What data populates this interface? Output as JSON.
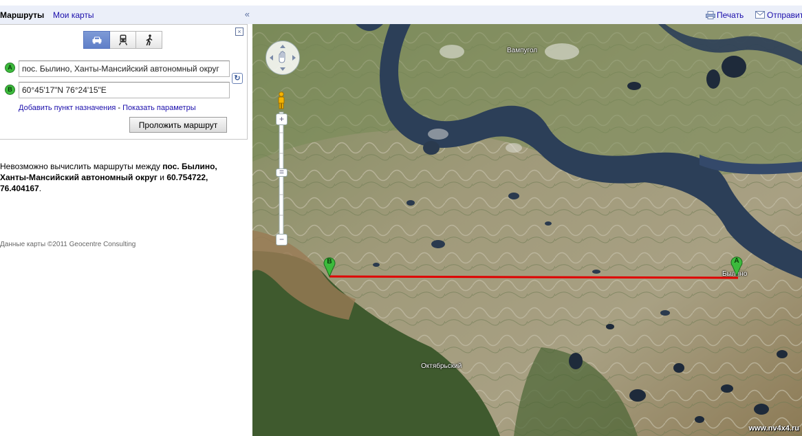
{
  "sidebar": {
    "tabs": {
      "directions": "Маршруты",
      "my_maps": "Мои карты"
    },
    "collapse_glyph": "«",
    "close_glyph": "×",
    "modes": [
      {
        "icon": "car-icon",
        "active": true
      },
      {
        "icon": "transit-icon",
        "active": false
      },
      {
        "icon": "walking-icon",
        "active": false
      }
    ],
    "route": {
      "a": {
        "marker": "A",
        "value": "пос. Былино, Ханты-Мансийский автономный округ"
      },
      "b": {
        "marker": "B",
        "value": "60°45'17\"N 76°24'15\"E"
      }
    },
    "links": {
      "add_destination": "Добавить пункт назначения",
      "separator": " - ",
      "show_options": "Показать параметры"
    },
    "get_directions_button": "Проложить маршрут",
    "error": {
      "prefix": "Невозможно вычислить маршруты между ",
      "origin": "пос. Былино, Ханты-Мансийский автономный округ",
      "conjunction": " и ",
      "destination": "60.754722, 76.404167",
      "suffix": "."
    },
    "credits": "Данные карты ©2011 Geocentre Consulting"
  },
  "header": {
    "print": "Печать",
    "send": "Отправить"
  },
  "map": {
    "labels": {
      "village_top": "Вампугол",
      "village_bottom": "Октябрьский",
      "village_right": "Былино"
    },
    "markers": {
      "a": "A",
      "b": "B"
    },
    "route_line_color": "#e00000",
    "watermark": "www.nv4x4.ru"
  },
  "colors": {
    "link": "#1a0dab",
    "tab_bar": "#ebeff9",
    "marker_green": "#3cba3c"
  }
}
